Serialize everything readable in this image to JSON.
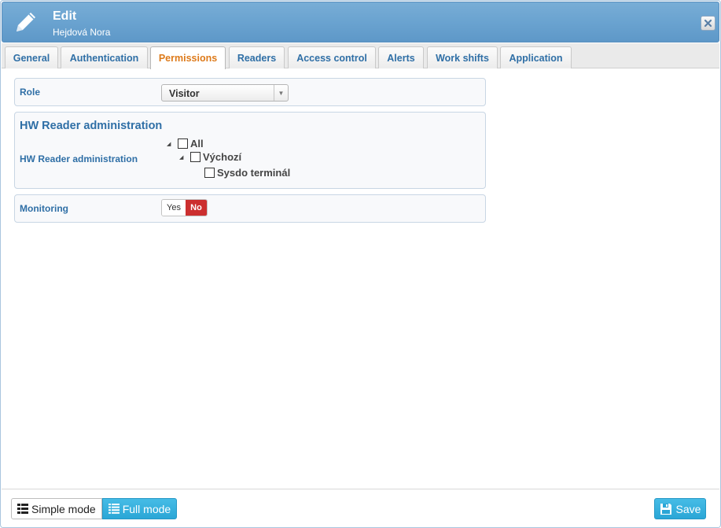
{
  "header": {
    "title": "Edit",
    "subtitle": "Hejdová Nora",
    "icon": "pencil-icon",
    "close_icon": "close-icon"
  },
  "tabs": [
    {
      "label": "General",
      "active": false
    },
    {
      "label": "Authentication",
      "active": false
    },
    {
      "label": "Permissions",
      "active": true
    },
    {
      "label": "Readers",
      "active": false
    },
    {
      "label": "Access control",
      "active": false
    },
    {
      "label": "Alerts",
      "active": false
    },
    {
      "label": "Work shifts",
      "active": false
    },
    {
      "label": "Application",
      "active": false
    }
  ],
  "role": {
    "label": "Role",
    "selected": "Visitor"
  },
  "hw_reader": {
    "section_title": "HW Reader administration",
    "label": "HW Reader administration",
    "tree": [
      {
        "label": "All",
        "checked": false
      },
      {
        "label": "Výchozí",
        "checked": false
      },
      {
        "label": "Sysdo terminál",
        "checked": false
      }
    ]
  },
  "monitoring": {
    "label": "Monitoring",
    "yes": "Yes",
    "no": "No",
    "value": "No"
  },
  "footer": {
    "simple_mode": "Simple mode",
    "full_mode": "Full mode",
    "save": "Save"
  },
  "colors": {
    "header": "#6aa3d0",
    "accent": "#2aa6d6",
    "active_tab": "#dd7a1a",
    "label": "#2f6fa6",
    "no_toggle": "#cc2f2f"
  }
}
